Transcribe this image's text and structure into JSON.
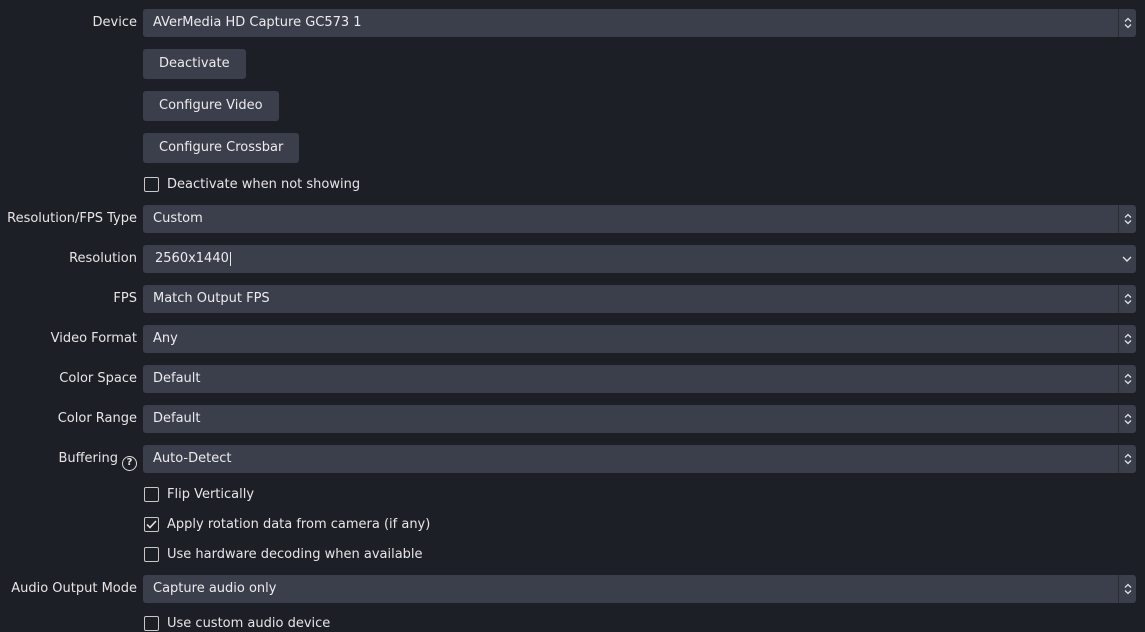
{
  "device": {
    "label": "Device",
    "value": "AVerMedia HD Capture GC573 1"
  },
  "buttons": {
    "deactivate": "Deactivate",
    "configure_video": "Configure Video",
    "configure_crossbar": "Configure Crossbar"
  },
  "checks": {
    "deactivate_when_not_showing": {
      "label": "Deactivate when not showing",
      "checked": false
    },
    "flip_vertically": {
      "label": "Flip Vertically",
      "checked": false
    },
    "apply_rotation": {
      "label": "Apply rotation data from camera (if any)",
      "checked": true
    },
    "hardware_decoding": {
      "label": "Use hardware decoding when available",
      "checked": false
    },
    "custom_audio_device": {
      "label": "Use custom audio device",
      "checked": false
    }
  },
  "resolution_fps_type": {
    "label": "Resolution/FPS Type",
    "value": "Custom"
  },
  "resolution": {
    "label": "Resolution",
    "value": "2560x1440"
  },
  "fps": {
    "label": "FPS",
    "value": "Match Output FPS"
  },
  "video_format": {
    "label": "Video Format",
    "value": "Any"
  },
  "color_space": {
    "label": "Color Space",
    "value": "Default"
  },
  "color_range": {
    "label": "Color Range",
    "value": "Default"
  },
  "buffering": {
    "label": "Buffering",
    "value": "Auto-Detect",
    "help_icon": "question-circle-icon"
  },
  "audio_output_mode": {
    "label": "Audio Output Mode",
    "value": "Capture audio only"
  }
}
